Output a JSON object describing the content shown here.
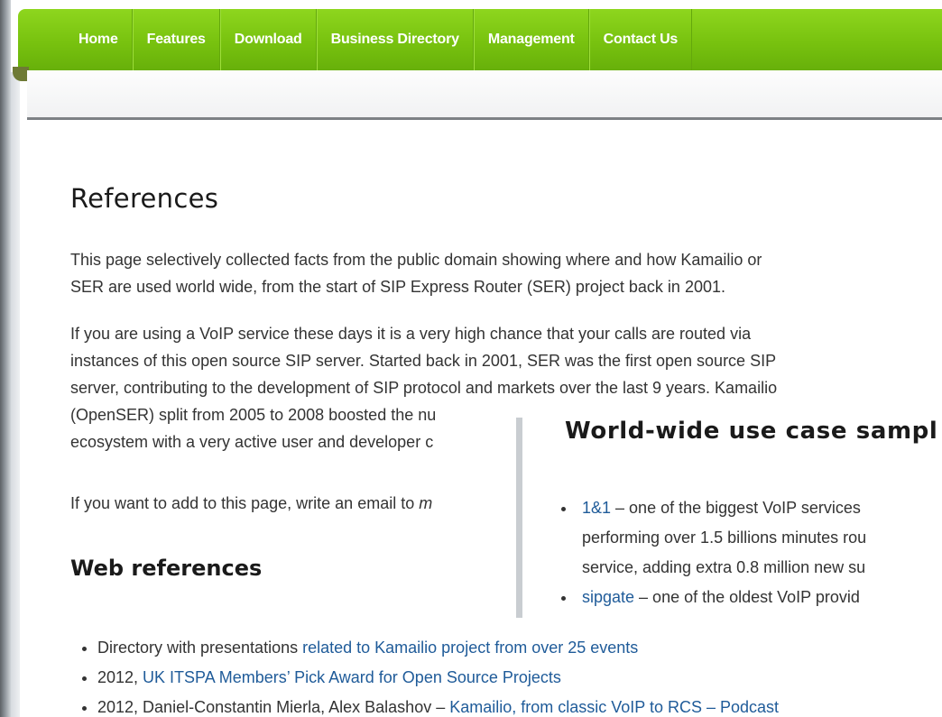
{
  "nav": {
    "items": [
      "Home",
      "Features",
      "Download",
      "Business Directory",
      "Management",
      "Contact Us"
    ]
  },
  "page": {
    "title": "References",
    "para1_line1": "This page selectively collected facts from the public domain showing where and how Kamailio or",
    "para1_line2": "SER are used world wide, from the start of SIP Express Router (SER) project back in 2001.",
    "para2_line1": "If you are using a VoIP service these days it is a very high chance that your calls are routed via",
    "para2_line2": "instances of this open source SIP server. Started back in 2001, SER was the first open source SIP",
    "para2_line3": "server, contributing to the development of SIP protocol and markets over the last 9 years. Kamailio",
    "para2_line4": "(OpenSER) split from 2005 to 2008 boosted the nu",
    "para2_line5": "ecosystem with a very active user and developer c",
    "para3_text": "If you want to add to this page, write an email to ",
    "para3_italic": "m"
  },
  "web_refs": {
    "heading": "Web references",
    "items": [
      {
        "prefix": "Directory with presentations ",
        "link": "related to Kamailio project from over 25 events"
      },
      {
        "prefix": "2012, ",
        "link": "UK ITSPA Members’ Pick Award for Open Source Projects"
      },
      {
        "prefix": "2012, Daniel-Constantin Mierla, Alex Balashov – ",
        "link": "Kamailio, from classic VoIP to RCS – Podcast"
      }
    ]
  },
  "overlay": {
    "heading": "World-wide use case sampl",
    "item1_link": "1&1",
    "item1_line1": " – one of the biggest VoIP services",
    "item1_line2": "performing over 1.5 billions minutes rou",
    "item1_line3": "service, adding extra 0.8 million new su",
    "item2_link": "sipgate",
    "item2_text": " – one of the oldest VoIP provid"
  },
  "colors": {
    "nav_green": "#7cc313",
    "link_blue": "#1f5b99",
    "text": "#333333"
  }
}
